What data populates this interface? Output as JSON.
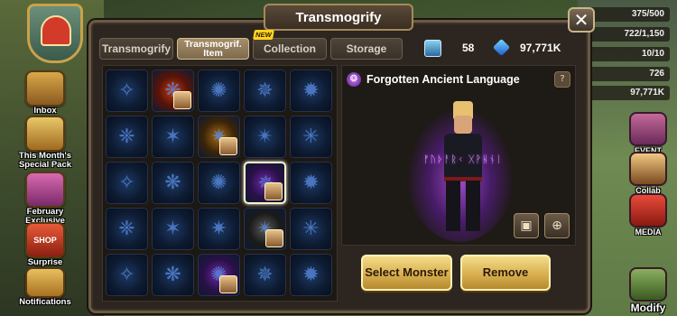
{
  "left_menu": {
    "inbox": "Inbox",
    "special_pack_1": "This Month's",
    "special_pack_2": "Special Pack",
    "february_1": "February",
    "february_2": "Exclusive",
    "shop_badge": "SHOP",
    "surprise_1": "Surprise",
    "surprise_2": "Shop",
    "notifications": "Notifications"
  },
  "resources": [
    "375/500",
    "722/1,150",
    "10/10",
    "726",
    "97,771K"
  ],
  "right_menu": {
    "event": "EVENT",
    "collab": "Collab Event",
    "media": "MEDIA",
    "modify": "Modify"
  },
  "window": {
    "title": "Transmogrify",
    "close": "✕"
  },
  "tabs": [
    {
      "label": "Transmogrify",
      "active": false
    },
    {
      "label": "Transmogrif. Item",
      "active": true
    },
    {
      "label": "Collection",
      "active": false,
      "badge": "NEW"
    },
    {
      "label": "Storage",
      "active": false
    }
  ],
  "currency": {
    "crystals_icon": "crystal-card-icon",
    "crystals": "58",
    "mana": "97,771K",
    "mana_icon": "blue-gem-icon"
  },
  "preview": {
    "title": "Forgotten Ancient Language",
    "info": "?",
    "runes": "ᚠᚢᚦᚨᚱᚲ ᚷᚹᚺᚾᛁ"
  },
  "buttons": {
    "camera": "▣",
    "zoom": "⊕",
    "select_monster": "Select Monster",
    "remove": "Remove"
  }
}
